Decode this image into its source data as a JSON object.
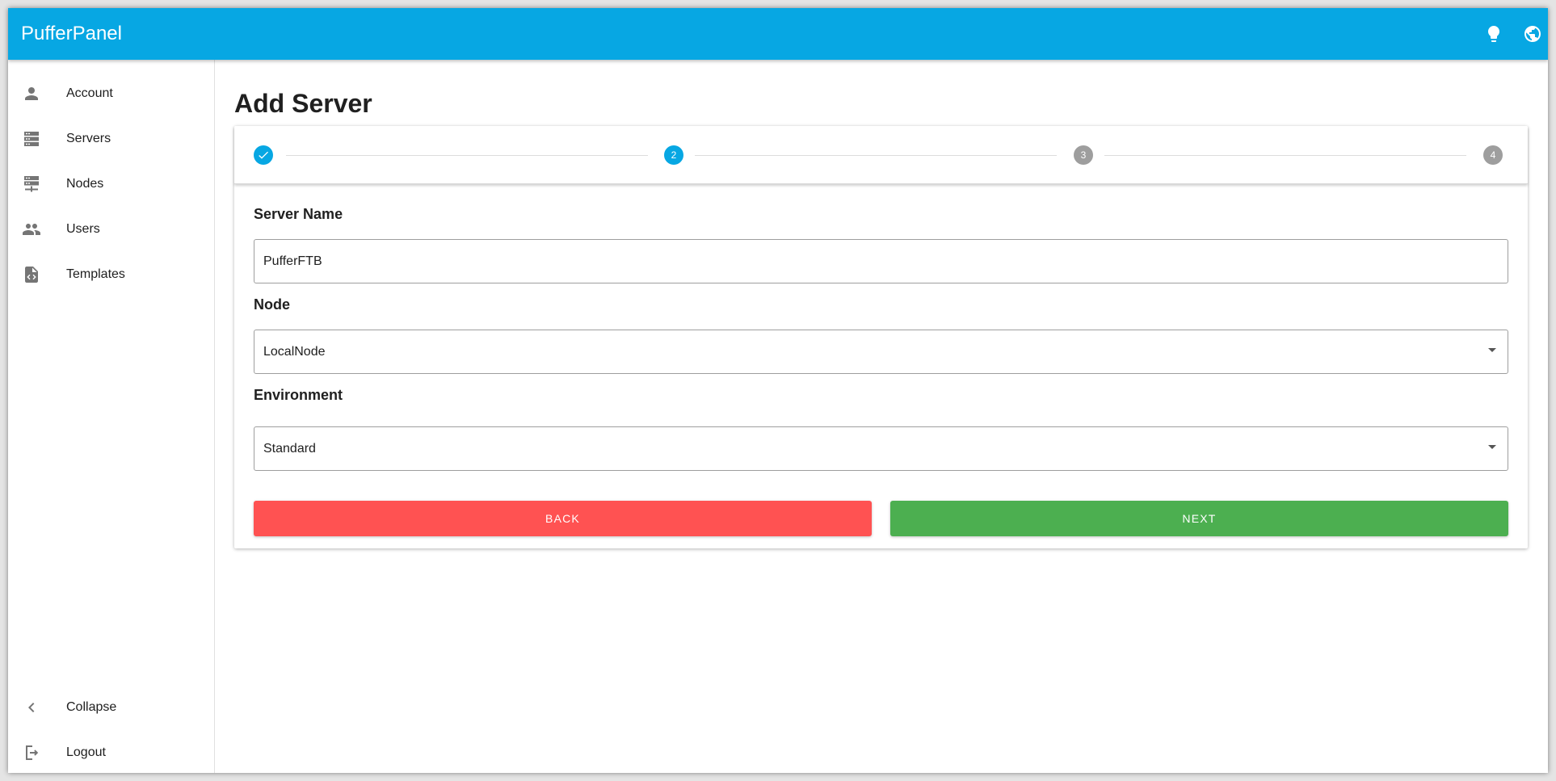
{
  "app": {
    "title": "PufferPanel"
  },
  "appbar": {
    "theme_icon": "lightbulb-icon",
    "language_icon": "globe-icon"
  },
  "sidebar": {
    "items": [
      {
        "label": "Account",
        "icon": "account-icon"
      },
      {
        "label": "Servers",
        "icon": "servers-icon"
      },
      {
        "label": "Nodes",
        "icon": "nodes-icon"
      },
      {
        "label": "Users",
        "icon": "users-icon"
      },
      {
        "label": "Templates",
        "icon": "templates-icon"
      }
    ],
    "collapse": {
      "label": "Collapse",
      "icon": "chevron-left-icon"
    },
    "logout": {
      "label": "Logout",
      "icon": "logout-icon"
    }
  },
  "page": {
    "title": "Add Server"
  },
  "stepper": {
    "steps": [
      {
        "label": "",
        "state": "complete"
      },
      {
        "label": "2",
        "state": "active"
      },
      {
        "label": "3",
        "state": "inactive"
      },
      {
        "label": "4",
        "state": "inactive"
      }
    ]
  },
  "form": {
    "server_name": {
      "label": "Server Name",
      "value": "PufferFTB"
    },
    "node": {
      "label": "Node",
      "value": "LocalNode"
    },
    "environment": {
      "label": "Environment",
      "value": "Standard"
    },
    "back_label": "BACK",
    "next_label": "NEXT"
  },
  "colors": {
    "primary": "#07a7e3",
    "inactive_step": "#9e9e9e",
    "back": "#ff5252",
    "next": "#4caf50"
  }
}
